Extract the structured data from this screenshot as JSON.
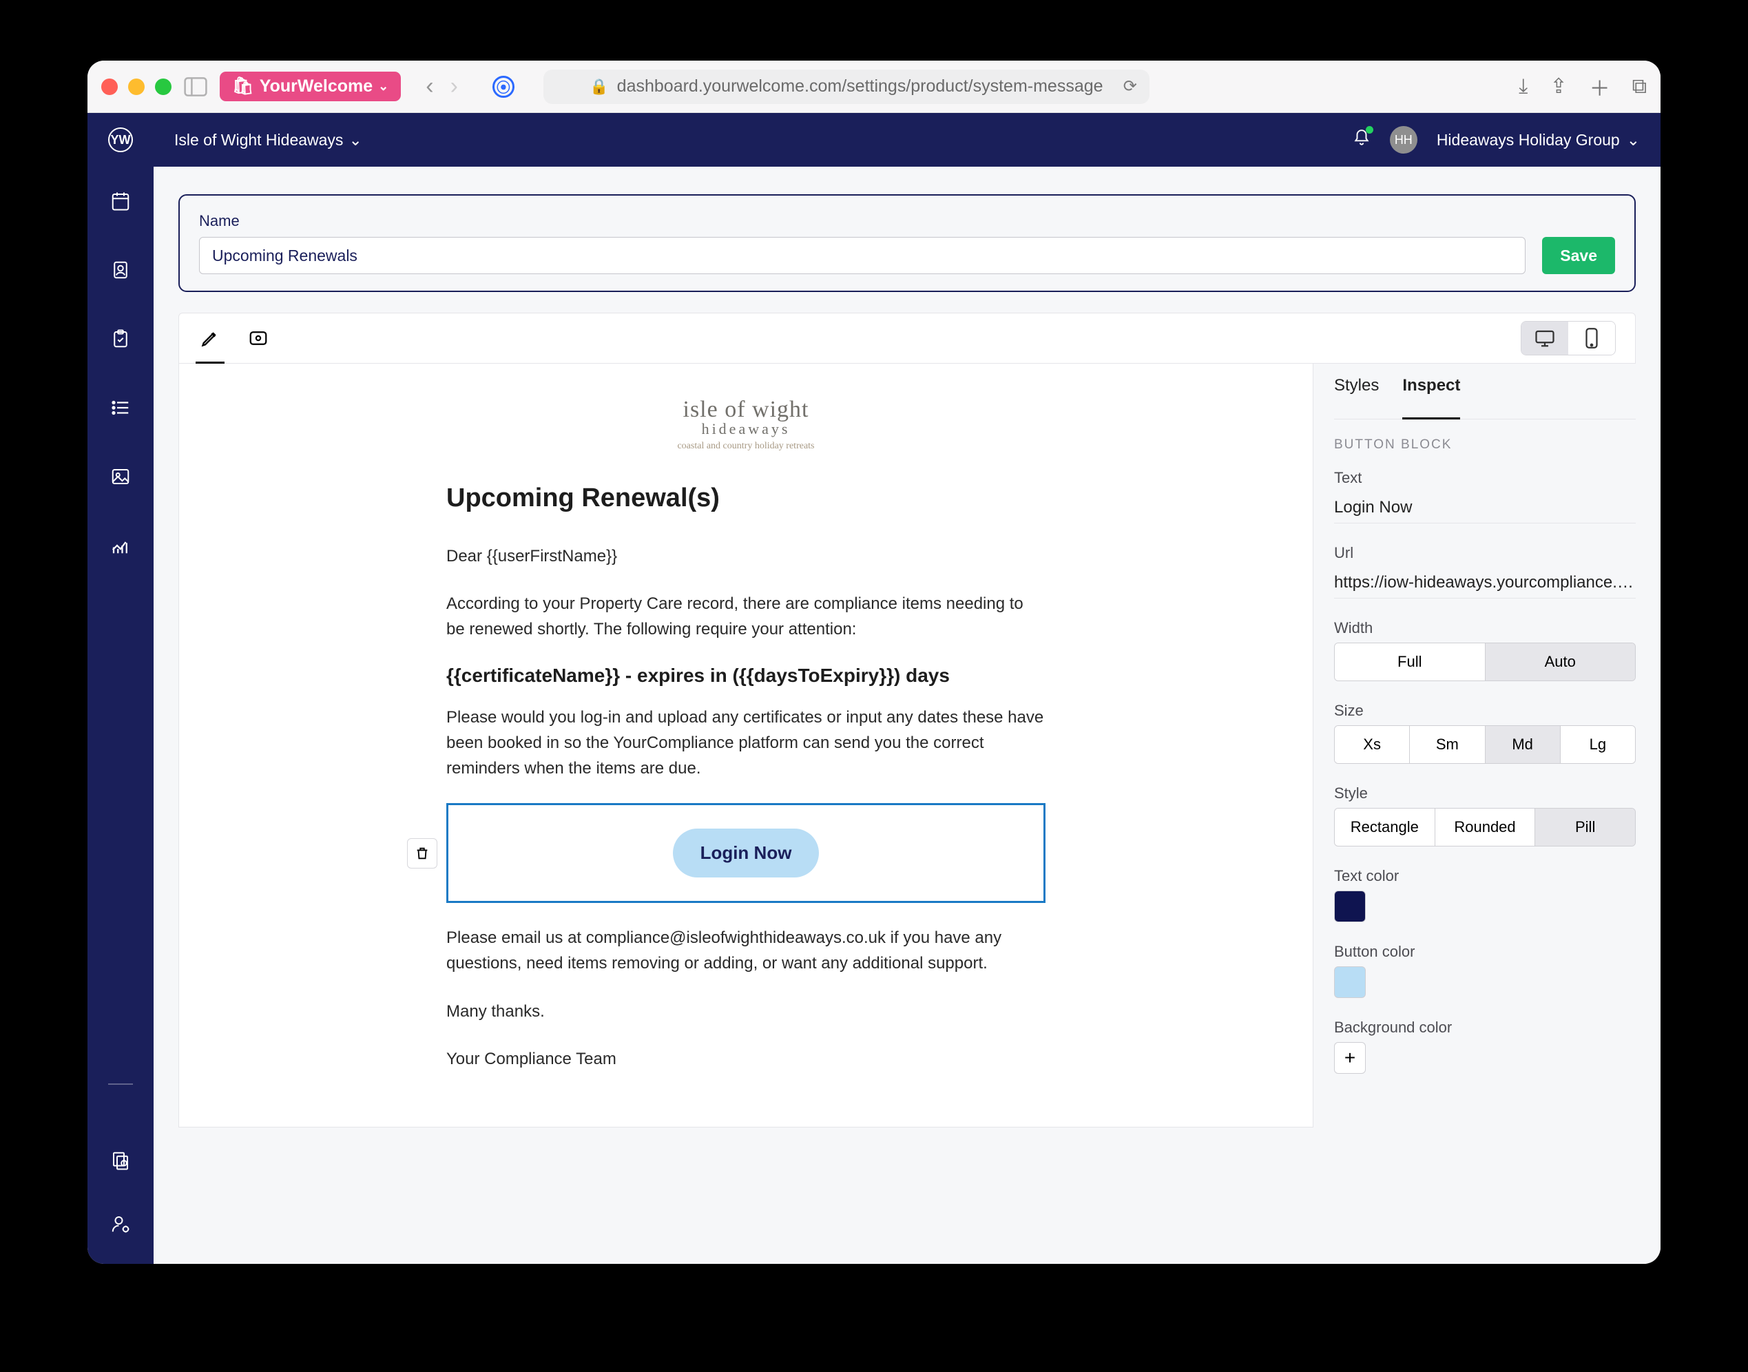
{
  "browser": {
    "extension_label": "YourWelcome",
    "url": "dashboard.yourwelcome.com/settings/product/system-message"
  },
  "header": {
    "logo_text": "YW",
    "property": "Isle of Wight Hideaways",
    "avatar_initials": "HH",
    "group": "Hideaways Holiday Group"
  },
  "name_card": {
    "label": "Name",
    "value": "Upcoming Renewals",
    "save": "Save"
  },
  "canvas": {
    "logo": {
      "l1": "isle of wight",
      "l2": "hideaways",
      "l3": "coastal and country holiday retreats"
    },
    "title": "Upcoming Renewal(s)",
    "greeting": "Dear {{userFirstName}}",
    "p1": "According to your Property Care record, there are compliance items needing to be renewed shortly. The following require your attention:",
    "cert_heading": "{{certificateName}} - expires in ({{daysToExpiry}}) days",
    "p2": "Please would you log-in and upload any certificates or input any dates these have been booked in so the YourCompliance platform can send you the correct reminders when the items are due.",
    "button_label": "Login Now",
    "p3": "Please email us at compliance@isleofwighthideaways.co.uk if you have any questions, need items removing or adding, or want any additional support.",
    "p4": "Many thanks.",
    "p5": "Your Compliance Team"
  },
  "panel": {
    "tabs": {
      "styles": "Styles",
      "inspect": "Inspect"
    },
    "section": "BUTTON BLOCK",
    "text_label": "Text",
    "text_value": "Login Now",
    "url_label": "Url",
    "url_value": "https://iow-hideaways.yourcompliance.com",
    "width_label": "Width",
    "width_opts": {
      "full": "Full",
      "auto": "Auto"
    },
    "size_label": "Size",
    "size_opts": {
      "xs": "Xs",
      "sm": "Sm",
      "md": "Md",
      "lg": "Lg"
    },
    "style_label": "Style",
    "style_opts": {
      "rect": "Rectangle",
      "round": "Rounded",
      "pill": "Pill"
    },
    "textcolor_label": "Text color",
    "textcolor_value": "#0f1450",
    "btncolor_label": "Button color",
    "btncolor_value": "#b8ddf5",
    "bgcolor_label": "Background color"
  }
}
